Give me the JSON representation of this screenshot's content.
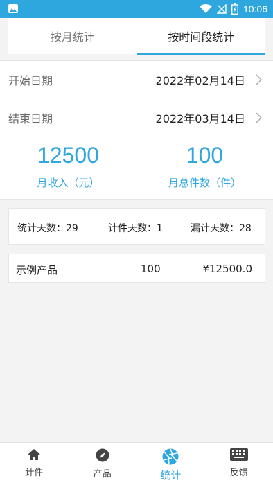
{
  "status_bar": {
    "time": "10:06",
    "icons": [
      "image-icon",
      "wifi-icon",
      "no-signal-icon",
      "battery-icon"
    ]
  },
  "tabs": [
    {
      "label": "按月统计",
      "active": false
    },
    {
      "label": "按时间段统计",
      "active": true
    }
  ],
  "date_range": {
    "start_label": "开始日期",
    "start_value": "2022年02月14日",
    "end_label": "结束日期",
    "end_value": "2022年03月14日"
  },
  "stats": {
    "income_value": "12500",
    "income_label": "月收入（元）",
    "pieces_value": "100",
    "pieces_label": "月总件数（件）"
  },
  "summary": {
    "stat_days": "统计天数：29",
    "piece_days": "计件天数：1",
    "missed_days": "漏计天数：28"
  },
  "products": [
    {
      "name": "示例产品",
      "count": "100",
      "amount": "¥12500.0"
    }
  ],
  "bottom_nav": [
    {
      "label": "计件",
      "icon": "home-icon",
      "active": false
    },
    {
      "label": "产品",
      "icon": "compass-icon",
      "active": false
    },
    {
      "label": "统计",
      "icon": "aperture-icon",
      "active": true
    },
    {
      "label": "反馈",
      "icon": "keyboard-icon",
      "active": false
    }
  ],
  "colors": {
    "accent": "#2ea6de",
    "background": "#f3f3f3"
  }
}
